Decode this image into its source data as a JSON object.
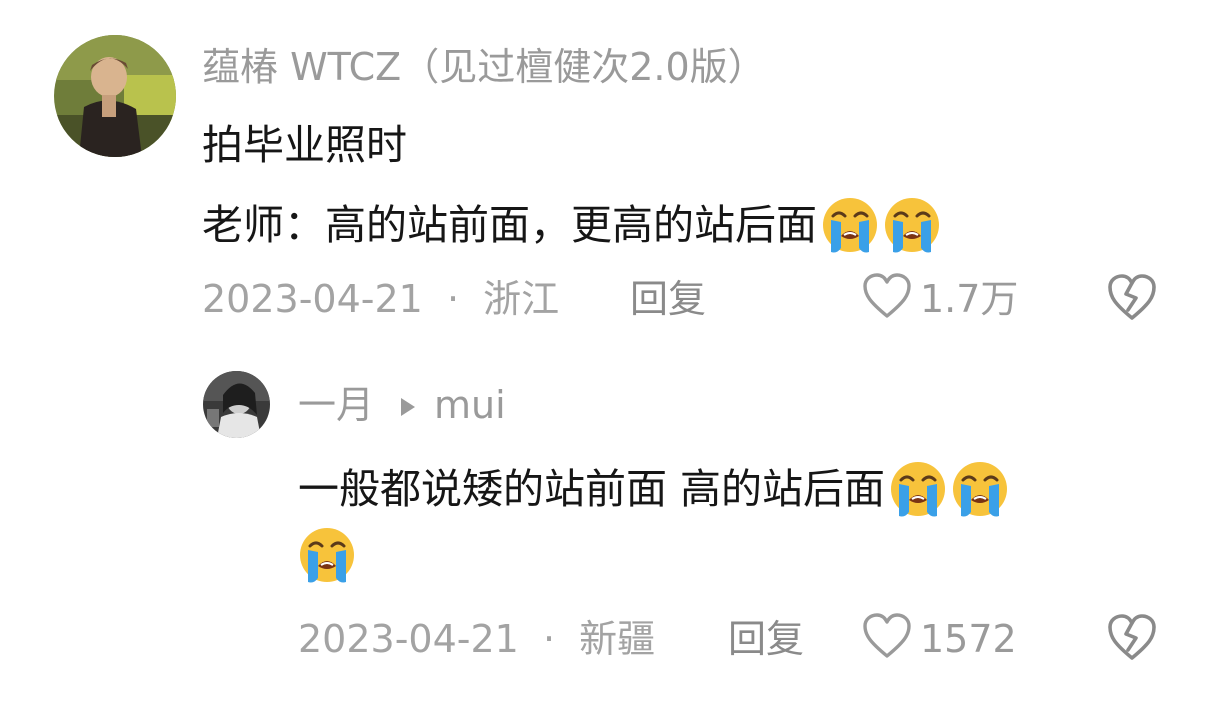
{
  "colors": {
    "primary_text": "#161616",
    "secondary_text": "#9a9a9a",
    "emoji_face": "#f7c33b",
    "emoji_tears": "#3aa0e8"
  },
  "comments": [
    {
      "username": "蕴椿 WTCZ（见过檀健次2.0版）",
      "lines": [
        {
          "text": "拍毕业照时",
          "emoji_count": 0
        },
        {
          "text": "老师：高的站前面，更高的站后面",
          "emoji_count": 2,
          "emoji_icon": "loudly-crying-face-icon"
        }
      ],
      "date": "2023-04-21",
      "separator": "·",
      "location": "浙江",
      "reply_label": "回复",
      "likes": "1.7万",
      "like_icon": "heart-outline-icon",
      "dislike_icon": "broken-heart-icon"
    }
  ],
  "replies": [
    {
      "username": "一月",
      "reply_to": "mui",
      "reply_arrow_icon": "reply-arrow-icon",
      "lines": [
        {
          "text": "一般都说矮的站前面 高的站后面",
          "emoji_count": 2,
          "emoji_icon": "loudly-crying-face-icon"
        },
        {
          "text": "",
          "emoji_count": 1,
          "emoji_icon": "loudly-crying-face-icon"
        }
      ],
      "date": "2023-04-21",
      "separator": "·",
      "location": "新疆",
      "reply_label": "回复",
      "likes": "1572",
      "like_icon": "heart-outline-icon",
      "dislike_icon": "broken-heart-icon"
    }
  ]
}
